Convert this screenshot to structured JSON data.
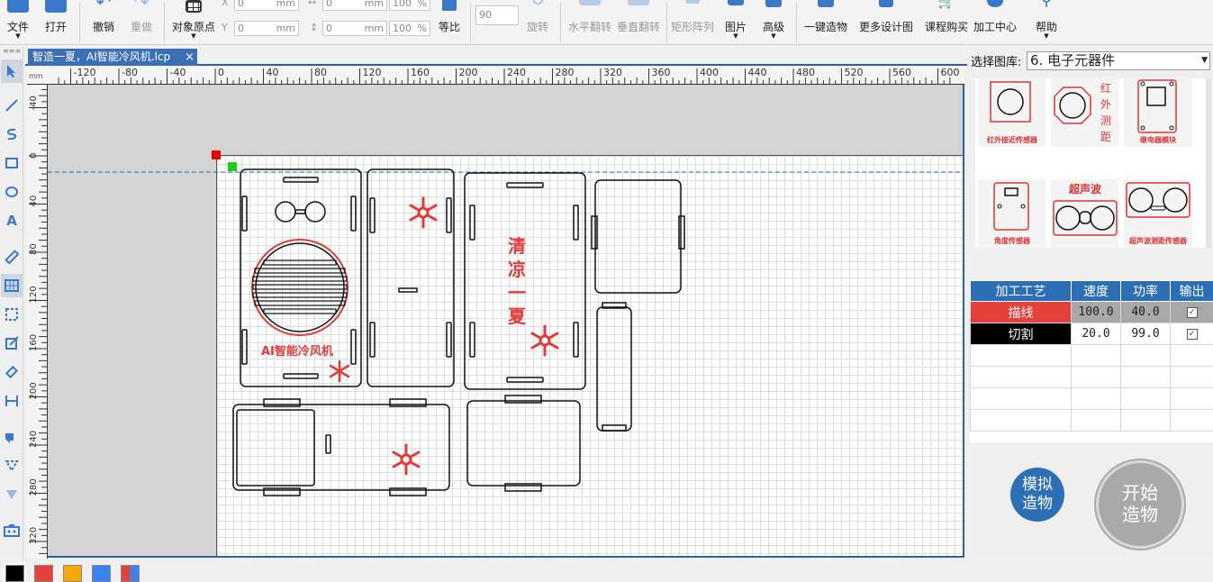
{
  "toolbar": {
    "file": "文件",
    "open": "打开",
    "undo": "撤销",
    "redo": "重做",
    "origin": "对象原点",
    "x_label": "X",
    "y_label": "Y",
    "x_val": "0",
    "y_val": "0",
    "w_val": "0",
    "h_val": "0",
    "unit": "mm",
    "scale_w": "100",
    "scale_h": "100",
    "pct": "%",
    "ratio": "等比",
    "rotate_val": "90",
    "rotate": "旋转",
    "hflip": "水平翻转",
    "vflip": "垂直翻转",
    "array": "矩形阵列",
    "image": "图片",
    "advanced": "高级",
    "one_click": "一键造物",
    "more": "更多设计图",
    "buy": "课程购买",
    "center": "加工中心",
    "help": "帮助"
  },
  "tab": {
    "title": "智造一夏，AI智能冷风机.lcp",
    "close": "×"
  },
  "ruler": {
    "unit": "mm",
    "h_ticks": [
      "-120",
      "-80",
      "-40",
      "0",
      "40",
      "80",
      "120",
      "160",
      "200",
      "240",
      "280",
      "320",
      "360",
      "400",
      "440",
      "480",
      "520",
      "560",
      "600"
    ],
    "v_ticks": [
      "-40",
      "0",
      "40",
      "80",
      "120",
      "160",
      "200",
      "240",
      "280",
      "320"
    ]
  },
  "design": {
    "text_ai": "AI智能冷风机",
    "text_cool": [
      "清",
      "凉",
      "一",
      "夏"
    ]
  },
  "library": {
    "label": "选择图库:",
    "value": "6. 电子元器件",
    "items": [
      {
        "caption": "红外接近传感器"
      },
      {
        "caption": "红外测距",
        "vertical": [
          "红",
          "外",
          "测",
          "距"
        ]
      },
      {
        "caption": "继电器模块"
      },
      {
        "caption": "角度传感器"
      },
      {
        "caption": "超声波测距传感器",
        "title": "超声波"
      },
      {
        "caption": "超声波测距传感器"
      }
    ]
  },
  "process": {
    "headers": [
      "加工工艺",
      "速度",
      "功率",
      "输出"
    ],
    "rows": [
      {
        "name": "描线",
        "speed": "100.0",
        "power": "40.0",
        "color": "#e5413a",
        "output": "✓"
      },
      {
        "name": "切割",
        "speed": "20.0",
        "power": "99.0",
        "color": "#000000",
        "output": "✓"
      }
    ]
  },
  "buttons": {
    "simulate": [
      "模拟",
      "造物"
    ],
    "start": [
      "开始",
      "造物"
    ]
  },
  "palette": [
    "#000000",
    "#e5413a",
    "#f5a800",
    "#3b82f0",
    "multi"
  ]
}
